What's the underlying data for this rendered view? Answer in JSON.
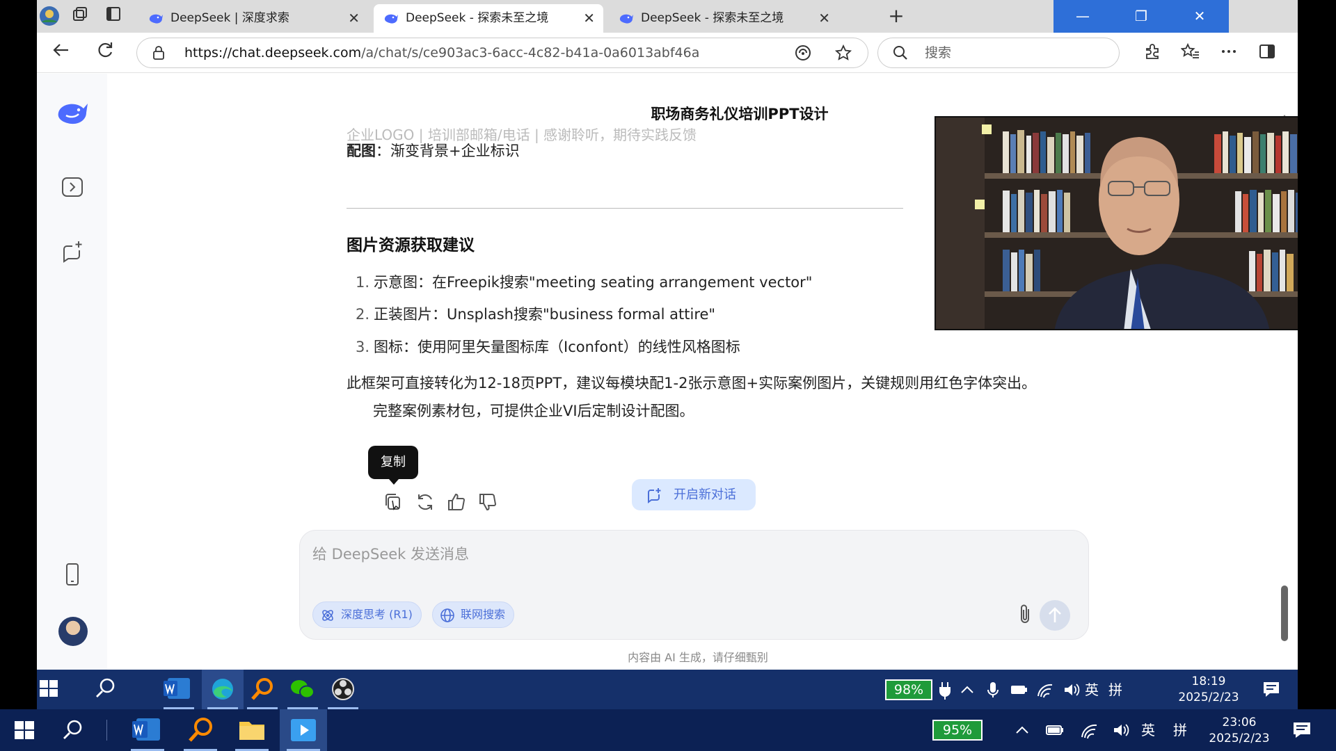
{
  "browser": {
    "tabs": [
      {
        "title": "DeepSeek | 深度求索",
        "active": false
      },
      {
        "title": "DeepSeek - 探索未至之境",
        "active": true
      },
      {
        "title": "DeepSeek - 探索未至之境",
        "active": false
      }
    ],
    "tab_close_glyph": "✕",
    "new_tab_glyph": "+",
    "url_host": "https://chat.deepseek.com",
    "url_path": "/a/chat/s/ce903ac3-6acc-4c82-b41a-0a6013abf46a",
    "search_placeholder": "搜索",
    "window_controls": [
      "—",
      "❐",
      "✕"
    ]
  },
  "chat": {
    "title": "职场商务礼仪培训PPT设计",
    "cut_line": "企业LOGO | 培训部邮箱/电话 | 感谢聆听，期待实践反馈",
    "illustration_label": "配图",
    "illustration_text": "：渐变背景+企业标识",
    "section_heading": "图片资源获取建议",
    "list": [
      {
        "num": "1.",
        "text": "示意图：在Freepik搜索\"meeting seating arrangement vector\""
      },
      {
        "num": "2.",
        "text": "正装图片：Unsplash搜索\"business formal attire\""
      },
      {
        "num": "3.",
        "text": "图标：使用阿里矢量图标库（Iconfont）的线性风格图标"
      }
    ],
    "closing_line1": "此框架可直接转化为12-18页PPT，建议每模块配1-2张示意图+实际案例图片，关键规则用红色字体突出。",
    "closing_line2": "完整案例素材包，可提供企业VI后定制设计配图。",
    "tooltip": "复制",
    "new_chat_label": "开启新对话",
    "composer_placeholder": "给 DeepSeek 发送消息",
    "chip_deep_think": "深度思考 (R1)",
    "chip_web_search": "联网搜索",
    "disclaimer": "内容由 AI 生成，请仔细甄别"
  },
  "taskbar_inner": {
    "battery": "98%",
    "ime": "英",
    "ime2": "拼",
    "time": "18:19",
    "date": "2025/2/23"
  },
  "taskbar_outer": {
    "battery": "95%",
    "ime": "英",
    "ime2": "拼",
    "time": "23:06",
    "date": "2025/2/23"
  },
  "colors": {
    "accent": "#4b6fd8",
    "taskbar_inner": "#15306a",
    "taskbar_outer": "#0c2154",
    "battery_green": "#1f9b3a"
  }
}
